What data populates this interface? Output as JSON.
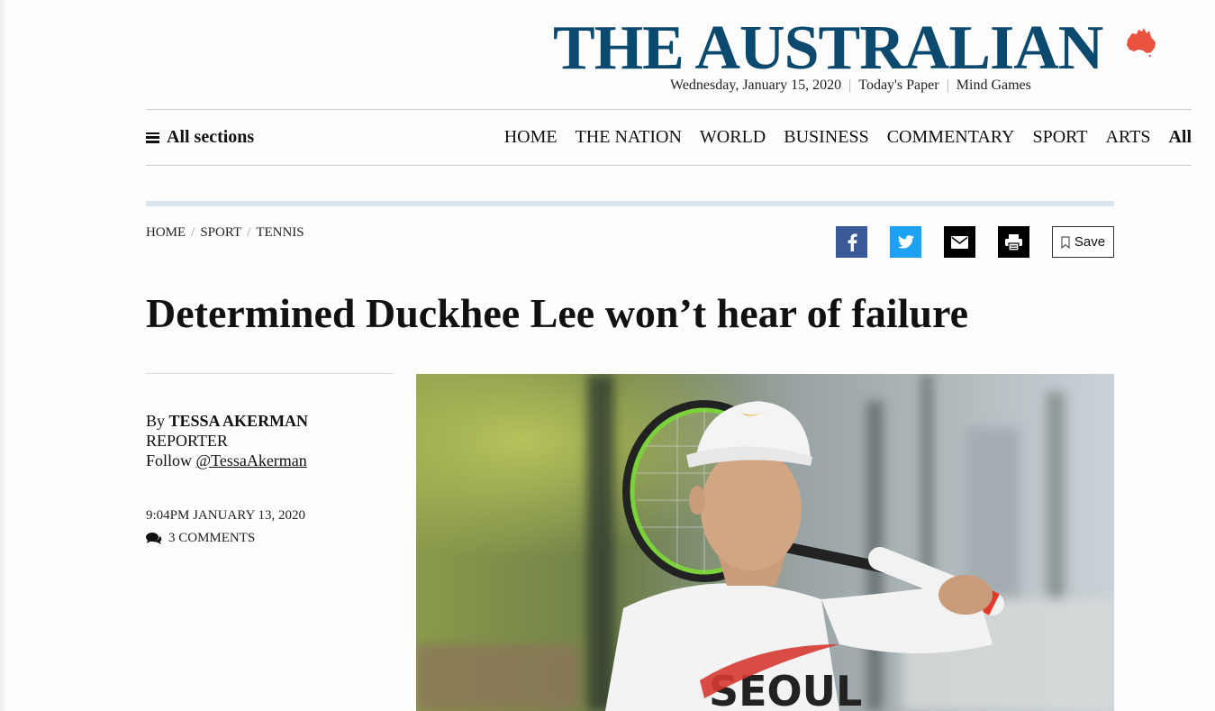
{
  "masthead": {
    "logo": "THE AUSTRALIAN",
    "date": "Wednesday, January 15, 2020",
    "links": [
      "Today's Paper",
      "Mind Games"
    ]
  },
  "nav": {
    "all_sections": "All sections",
    "items": [
      "HOME",
      "THE NATION",
      "WORLD",
      "BUSINESS",
      "COMMENTARY",
      "SPORT",
      "ARTS",
      "All"
    ]
  },
  "breadcrumb": [
    "HOME",
    "SPORT",
    "TENNIS"
  ],
  "share": {
    "save_label": "Save",
    "icons": [
      "facebook-icon",
      "twitter-icon",
      "email-icon",
      "print-icon"
    ]
  },
  "article": {
    "headline": "Determined Duckhee Lee won’t hear of failure",
    "byline_prefix": "By",
    "author": "TESSA AKERMAN",
    "role": "REPORTER",
    "follow_prefix": "Follow",
    "follow_handle": "@TessaAkerman",
    "timestamp": "9:04PM JANUARY 13, 2020",
    "comments": "3 COMMENTS",
    "photo_shirt_text": "SEOUL"
  },
  "colors": {
    "brand": "#0b4a6e",
    "facebook": "#3b5998",
    "twitter": "#1da1f2",
    "accent_rule": "#d6e5ee",
    "map": "#e8523f"
  }
}
